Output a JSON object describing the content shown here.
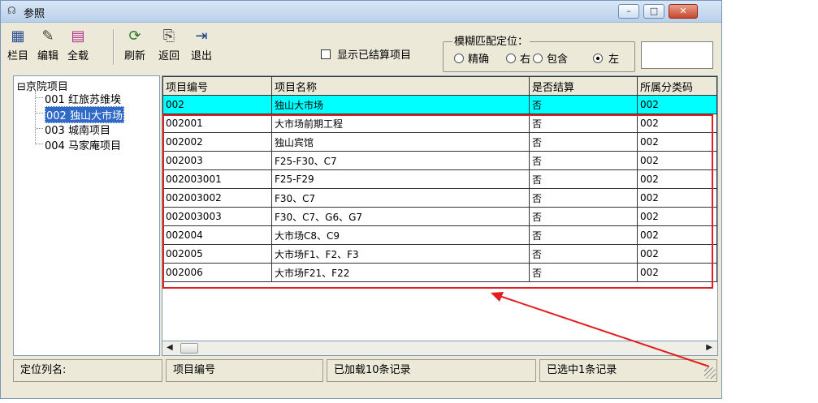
{
  "window": {
    "title": "参照",
    "title_icon": "reference-icon"
  },
  "toolbar": {
    "buttons": [
      {
        "label": "栏目",
        "icon": "columns-icon"
      },
      {
        "label": "编辑",
        "icon": "edit-icon"
      },
      {
        "label": "全载",
        "icon": "load-all-icon"
      },
      {
        "label": "刷新",
        "icon": "refresh-icon"
      },
      {
        "label": "返回",
        "icon": "return-icon"
      },
      {
        "label": "退出",
        "icon": "exit-icon"
      }
    ]
  },
  "show_settled": {
    "label": "显示已结算项目",
    "checked": false
  },
  "fuzzy": {
    "title": "模糊匹配定位：",
    "options": [
      "精确",
      "右",
      "包含",
      "左"
    ],
    "selected": "左",
    "input_value": ""
  },
  "tree": {
    "root": "京院项目",
    "items": [
      {
        "label": "001 红旅苏维埃",
        "selected": false
      },
      {
        "label": "002 独山大市场",
        "selected": true
      },
      {
        "label": "003 城南项目",
        "selected": false
      },
      {
        "label": "004 马家庵项目",
        "selected": false
      }
    ]
  },
  "grid": {
    "columns": [
      "项目编号",
      "项目名称",
      "是否结算",
      "所属分类码"
    ],
    "rows": [
      [
        "002",
        "独山大市场",
        "否",
        "002"
      ],
      [
        "002001",
        "大市场前期工程",
        "否",
        "002"
      ],
      [
        "002002",
        "独山宾馆",
        "否",
        "002"
      ],
      [
        "002003",
        "F25-F30、C7",
        "否",
        "002"
      ],
      [
        "002003001",
        "F25-F29",
        "否",
        "002"
      ],
      [
        "002003002",
        "F30、C7",
        "否",
        "002"
      ],
      [
        "002003003",
        "F30、C7、G6、G7",
        "否",
        "002"
      ],
      [
        "002004",
        "大市场C8、C9",
        "否",
        "002"
      ],
      [
        "002005",
        "大市场F1、F2、F3",
        "否",
        "002"
      ],
      [
        "002006",
        "大市场F21、F22",
        "否",
        "002"
      ]
    ],
    "selected_row": 0
  },
  "status": {
    "locate_label": "定位列名:",
    "locate_column": "项目编号",
    "loaded": "已加载10条记录",
    "selected": "已选中1条记录"
  },
  "colors": {
    "selected_row": "#00ffff",
    "annotation": "#e02020",
    "tree_selected": "#3169c6"
  }
}
